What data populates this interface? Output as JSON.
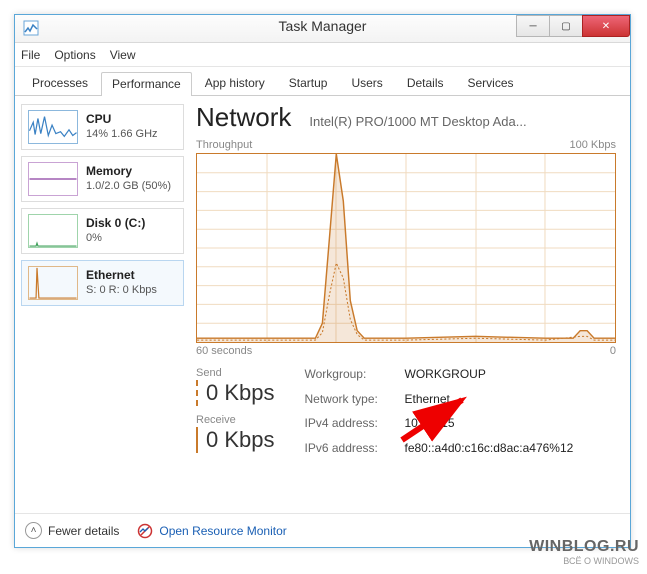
{
  "window": {
    "title": "Task Manager"
  },
  "menu": {
    "file": "File",
    "options": "Options",
    "view": "View"
  },
  "tabs": {
    "processes": "Processes",
    "performance": "Performance",
    "apphistory": "App history",
    "startup": "Startup",
    "users": "Users",
    "details": "Details",
    "services": "Services"
  },
  "tiles": {
    "cpu": {
      "title": "CPU",
      "sub": "14%  1.66 GHz",
      "color": "#3b82c4"
    },
    "memory": {
      "title": "Memory",
      "sub": "1.0/2.0 GB (50%)",
      "color": "#8b3fa0"
    },
    "disk": {
      "title": "Disk 0 (C:)",
      "sub": "0%",
      "color": "#3fa05a"
    },
    "ethernet": {
      "title": "Ethernet",
      "sub": "S: 0 R: 0 Kbps",
      "color": "#c97a2b"
    }
  },
  "main": {
    "title": "Network",
    "adapter": "Intel(R) PRO/1000 MT Desktop Ada...",
    "throughput_label": "Throughput",
    "ymax_label": "100 Kbps",
    "xleft": "60 seconds",
    "xright": "0"
  },
  "sr": {
    "send_label": "Send",
    "send_value": "0 Kbps",
    "recv_label": "Receive",
    "recv_value": "0 Kbps"
  },
  "net": {
    "workgroup_l": "Workgroup:",
    "workgroup_v": "WORKGROUP",
    "type_l": "Network type:",
    "type_v": "Ethernet",
    "ipv4_l": "IPv4 address:",
    "ipv4_v": "10.0.2.15",
    "ipv6_l": "IPv6 address:",
    "ipv6_v": "fe80::a4d0:c16c:d8ac:a476%12"
  },
  "footer": {
    "fewer": "Fewer details",
    "orm": "Open Resource Monitor"
  },
  "watermark": {
    "line1": "WINBLOG.RU",
    "line2": "ВСЁ О WINDOWS"
  },
  "chart_data": {
    "type": "line",
    "title": "Throughput",
    "xlabel": "seconds",
    "ylabel": "Kbps",
    "xlim": [
      60,
      0
    ],
    "ylim": [
      0,
      100
    ],
    "series": [
      {
        "name": "Receive",
        "x": [
          60,
          50,
          43,
          42,
          41,
          40,
          39,
          38,
          37,
          36,
          30,
          20,
          10,
          6,
          5,
          4,
          3,
          0
        ],
        "values": [
          2,
          2,
          2,
          10,
          55,
          100,
          75,
          22,
          6,
          2,
          2,
          3,
          2,
          2,
          6,
          6,
          2,
          2
        ]
      },
      {
        "name": "Send",
        "x": [
          60,
          50,
          43,
          42,
          41,
          40,
          39,
          38,
          37,
          36,
          30,
          20,
          10,
          5,
          4,
          3,
          0
        ],
        "values": [
          1,
          1,
          1,
          5,
          25,
          42,
          34,
          12,
          4,
          1,
          1,
          2,
          1,
          3,
          3,
          1,
          1
        ]
      }
    ]
  }
}
